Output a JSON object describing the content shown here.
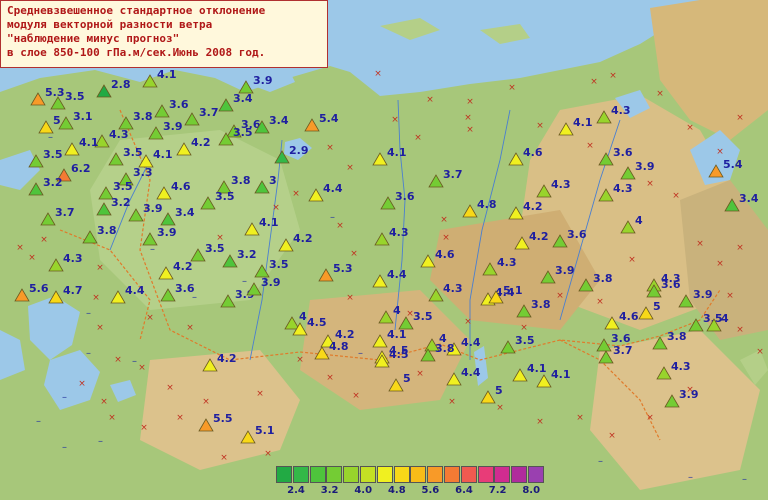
{
  "title_lines": [
    "Средневзвешенное стандартное отклонение",
    "модуля векторной разности ветра",
    "\"наблюдение минус прогноз\"",
    "в слое 850-100 гПа.м/сек.Июнь 2008 год."
  ],
  "legend": {
    "colors": [
      "#22aa44",
      "#33b848",
      "#4ec43c",
      "#74cc34",
      "#98d42c",
      "#c4e024",
      "#f0f020",
      "#f8d818",
      "#f8bc18",
      "#f89a28",
      "#f47a34",
      "#f05a50",
      "#e83c78",
      "#d02c90",
      "#b02c9c",
      "#9a40b0"
    ],
    "tick_labels": [
      "2.4",
      "3.2",
      "4.0",
      "4.8",
      "5.6",
      "6.4",
      "7.2",
      "8.0"
    ]
  },
  "stations": [
    {
      "v": "5.3",
      "c": "#f89a28"
    },
    {
      "v": "3.5",
      "c": "#74cc34"
    },
    {
      "v": "2.8",
      "c": "#22aa44"
    },
    {
      "v": "4.1",
      "c": "#98d42c"
    },
    {
      "v": "3.9",
      "c": "#74cc34"
    },
    {
      "v": "5",
      "c": "#f8d818"
    },
    {
      "v": "3.1",
      "c": "#74cc34"
    },
    {
      "v": "3.8",
      "c": "#74cc34"
    },
    {
      "v": "3.6",
      "c": "#74cc34"
    },
    {
      "v": "3.4",
      "c": "#4ec43c"
    },
    {
      "v": "3.7",
      "c": "#74cc34"
    },
    {
      "v": "3.6",
      "c": "#74cc34"
    },
    {
      "v": "3.4",
      "c": "#4ec43c"
    },
    {
      "v": "5.4",
      "c": "#f89a28"
    },
    {
      "v": "4.3",
      "c": "#98d42c"
    },
    {
      "v": "3.9",
      "c": "#74cc34"
    },
    {
      "v": "4.1",
      "c": "#f0f020"
    },
    {
      "v": "4.1",
      "c": "#f0f020"
    },
    {
      "v": "4.2",
      "c": "#f0f020"
    },
    {
      "v": "3.5",
      "c": "#74cc34"
    },
    {
      "v": "3.5",
      "c": "#74cc34"
    },
    {
      "v": "4.1",
      "c": "#f0f020"
    },
    {
      "v": "2.9",
      "c": "#33b848"
    },
    {
      "v": "4.3",
      "c": "#98d42c"
    },
    {
      "v": "4.6",
      "c": "#f0f020"
    },
    {
      "v": "4.1",
      "c": "#f0f020"
    },
    {
      "v": "3.5",
      "c": "#74cc34"
    },
    {
      "v": "6.2",
      "c": "#f47a34"
    },
    {
      "v": "3.3",
      "c": "#74cc34"
    },
    {
      "v": "3.2",
      "c": "#4ec43c"
    },
    {
      "v": "3.5",
      "c": "#74cc34"
    },
    {
      "v": "4.6",
      "c": "#f0f020"
    },
    {
      "v": "3.8",
      "c": "#74cc34"
    },
    {
      "v": "3",
      "c": "#4ec43c"
    },
    {
      "v": "4.4",
      "c": "#f0f020"
    },
    {
      "v": "3.7",
      "c": "#74cc34"
    },
    {
      "v": "3.6",
      "c": "#74cc34"
    },
    {
      "v": "3.9",
      "c": "#74cc34"
    },
    {
      "v": "4.3",
      "c": "#98d42c"
    },
    {
      "v": "3.5",
      "c": "#74cc34"
    },
    {
      "v": "5.4",
      "c": "#f89a28"
    },
    {
      "v": "3.4",
      "c": "#4ec43c"
    },
    {
      "v": "3.2",
      "c": "#4ec43c"
    },
    {
      "v": "3.9",
      "c": "#74cc34"
    },
    {
      "v": "3.4",
      "c": "#4ec43c"
    },
    {
      "v": "3.7",
      "c": "#74cc34"
    },
    {
      "v": "4.8",
      "c": "#f8d818"
    },
    {
      "v": "4.2",
      "c": "#f0f020"
    },
    {
      "v": "3.6",
      "c": "#74cc34"
    },
    {
      "v": "4.3",
      "c": "#98d42c"
    },
    {
      "v": "4.1",
      "c": "#f0f020"
    },
    {
      "v": "4",
      "c": "#98d42c"
    },
    {
      "v": "4.3",
      "c": "#98d42c"
    },
    {
      "v": "3.8",
      "c": "#74cc34"
    },
    {
      "v": "3.9",
      "c": "#74cc34"
    },
    {
      "v": "4.2",
      "c": "#f0f020"
    },
    {
      "v": "3.6",
      "c": "#74cc34"
    },
    {
      "v": "3.5",
      "c": "#74cc34"
    },
    {
      "v": "3.2",
      "c": "#4ec43c"
    },
    {
      "v": "4.2",
      "c": "#f0f020"
    },
    {
      "v": "4.6",
      "c": "#f0f020"
    },
    {
      "v": "4.3",
      "c": "#98d42c"
    },
    {
      "v": "4.3",
      "c": "#98d42c"
    },
    {
      "v": "5.3",
      "c": "#f89a28"
    },
    {
      "v": "4.4",
      "c": "#f0f020"
    },
    {
      "v": "4.2",
      "c": "#f0f020"
    },
    {
      "v": "3.5",
      "c": "#74cc34"
    },
    {
      "v": "3.9",
      "c": "#74cc34"
    },
    {
      "v": "3.6",
      "c": "#74cc34"
    },
    {
      "v": "3.8",
      "c": "#74cc34"
    },
    {
      "v": "4.3",
      "c": "#98d42c"
    },
    {
      "v": "3.6",
      "c": "#74cc34"
    },
    {
      "v": "5.6",
      "c": "#f89a28"
    },
    {
      "v": "4.7",
      "c": "#f8d818"
    },
    {
      "v": "4.4",
      "c": "#f0f020"
    },
    {
      "v": "3.9",
      "c": "#74cc34"
    },
    {
      "v": "5",
      "c": "#f8d818"
    },
    {
      "v": "3.9",
      "c": "#74cc34"
    },
    {
      "v": "4.3",
      "c": "#98d42c"
    },
    {
      "v": "4.4",
      "c": "#f0f020"
    },
    {
      "v": "5.1",
      "c": "#f8d818"
    },
    {
      "v": "3.9",
      "c": "#74cc34"
    },
    {
      "v": "3.5",
      "c": "#74cc34"
    },
    {
      "v": "3.8",
      "c": "#74cc34"
    },
    {
      "v": "4.6",
      "c": "#f0f020"
    },
    {
      "v": "4",
      "c": "#98d42c"
    },
    {
      "v": "4.5",
      "c": "#f0f020"
    },
    {
      "v": "4",
      "c": "#98d42c"
    },
    {
      "v": "3.5",
      "c": "#74cc34"
    },
    {
      "v": "3.6",
      "c": "#74cc34"
    },
    {
      "v": "4.2",
      "c": "#f0f020"
    },
    {
      "v": "4.1",
      "c": "#f0f020"
    },
    {
      "v": "4",
      "c": "#98d42c"
    },
    {
      "v": "4.4",
      "c": "#f0f020"
    },
    {
      "v": "4.8",
      "c": "#f8d818"
    },
    {
      "v": "4.5",
      "c": "#f0f020"
    },
    {
      "v": "3.8",
      "c": "#74cc34"
    },
    {
      "v": "3.7",
      "c": "#74cc34"
    },
    {
      "v": "3.8",
      "c": "#74cc34"
    },
    {
      "v": "3.5",
      "c": "#74cc34"
    },
    {
      "v": "4",
      "c": "#98d42c"
    },
    {
      "v": "4.5",
      "c": "#f0f020"
    },
    {
      "v": "4.2",
      "c": "#f0f020"
    },
    {
      "v": "5",
      "c": "#f8d818"
    },
    {
      "v": "4.4",
      "c": "#f0f020"
    },
    {
      "v": "4.3",
      "c": "#98d42c"
    },
    {
      "v": "4.1",
      "c": "#f0f020"
    },
    {
      "v": "5",
      "c": "#f8d818"
    },
    {
      "v": "4.1",
      "c": "#f0f020"
    },
    {
      "v": "3.9",
      "c": "#74cc34"
    },
    {
      "v": "5.5",
      "c": "#f89a28"
    },
    {
      "v": "5.1",
      "c": "#f8d818"
    }
  ]
}
